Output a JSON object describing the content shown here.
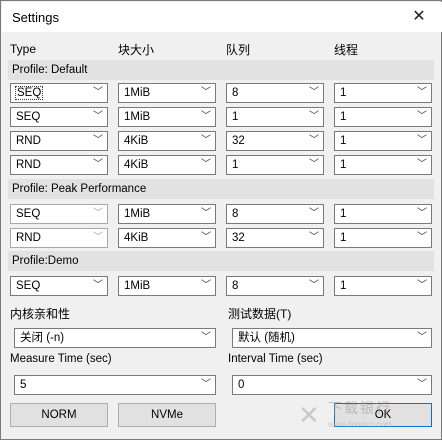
{
  "window": {
    "title": "Settings",
    "close_glyph": "✕"
  },
  "headers": {
    "type": "Type",
    "block": "块大小",
    "queue": "队列",
    "threads": "线程"
  },
  "profiles": {
    "default": {
      "label": "Profile: Default",
      "rows": [
        {
          "type": "SEQ",
          "block": "1MiB",
          "queue": "8",
          "threads": "1"
        },
        {
          "type": "SEQ",
          "block": "1MiB",
          "queue": "1",
          "threads": "1"
        },
        {
          "type": "RND",
          "block": "4KiB",
          "queue": "32",
          "threads": "1"
        },
        {
          "type": "RND",
          "block": "4KiB",
          "queue": "1",
          "threads": "1"
        }
      ]
    },
    "peak": {
      "label": "Profile: Peak Performance",
      "rows": [
        {
          "type": "SEQ",
          "block": "1MiB",
          "queue": "8",
          "threads": "1"
        },
        {
          "type": "RND",
          "block": "4KiB",
          "queue": "32",
          "threads": "1"
        }
      ]
    },
    "demo": {
      "label": "Profile:Demo",
      "rows": [
        {
          "type": "SEQ",
          "block": "1MiB",
          "queue": "8",
          "threads": "1"
        }
      ]
    }
  },
  "affinity": {
    "label": "内核亲和性",
    "value": "关闭 (-n)"
  },
  "test_data": {
    "label": "测试数据(T)",
    "value": "默认 (随机)"
  },
  "measure_time": {
    "label": "Measure Time (sec)",
    "value": "5"
  },
  "interval_time": {
    "label": "Interval Time (sec)",
    "value": "0"
  },
  "buttons": {
    "norm": "NORM",
    "nvme": "NVMe",
    "ok": "OK"
  },
  "watermark": {
    "text": "下载银行",
    "url": "www.downcc.com"
  },
  "icons": {
    "dropdown": "chevron-down-icon",
    "close": "close-icon"
  }
}
